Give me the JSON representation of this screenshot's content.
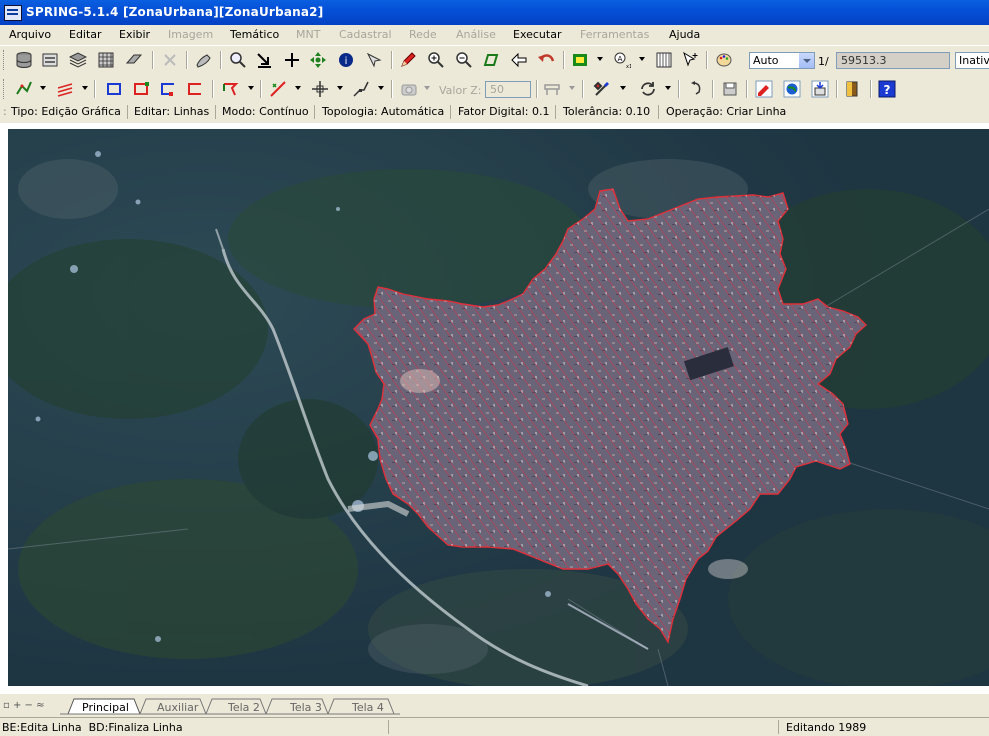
{
  "window": {
    "title": "SPRING-5.1.4 [ZonaUrbana][ZonaUrbana2]"
  },
  "menu": [
    {
      "label": "Arquivo",
      "enabled": true
    },
    {
      "label": "Editar",
      "enabled": true
    },
    {
      "label": "Exibir",
      "enabled": true
    },
    {
      "label": "Imagem",
      "enabled": false
    },
    {
      "label": "Temático",
      "enabled": true
    },
    {
      "label": "MNT",
      "enabled": false
    },
    {
      "label": "Cadastral",
      "enabled": false
    },
    {
      "label": "Rede",
      "enabled": false
    },
    {
      "label": "Análise",
      "enabled": false
    },
    {
      "label": "Executar",
      "enabled": true
    },
    {
      "label": "Ferramentas",
      "enabled": false
    },
    {
      "label": "Ajuda",
      "enabled": true
    }
  ],
  "toolbar": {
    "zoom_mode": "Auto",
    "scale_prefix": "1/",
    "scale_value": "59513.3",
    "inactive_label": "Inativ",
    "valor_z_label": "Valor Z:",
    "valor_z_value": "50"
  },
  "edit_info": {
    "tipo": "Tipo: Edição Gráfica",
    "editar": "Editar: Linhas",
    "modo": "Modo: Contínuo",
    "topologia": "Topologia: Automática",
    "fator": "Fator Digital: 0.1",
    "tolerancia": "Tolerância: 0.10",
    "operacao": "Operação: Criar Linha"
  },
  "tabs": [
    {
      "label": "Principal",
      "active": true
    },
    {
      "label": "Auxiliar",
      "active": false
    },
    {
      "label": "Tela 2",
      "active": false
    },
    {
      "label": "Tela 3",
      "active": false
    },
    {
      "label": "Tela 4",
      "active": false
    }
  ],
  "statusbar": {
    "hint": "BE:Edita Linha  BD:Finaliza Linha",
    "mode": "Editando 1989"
  },
  "colors": {
    "polygon_outline": "#e0303a",
    "hatch": "#d04050",
    "titlebar": "#0550d8"
  }
}
